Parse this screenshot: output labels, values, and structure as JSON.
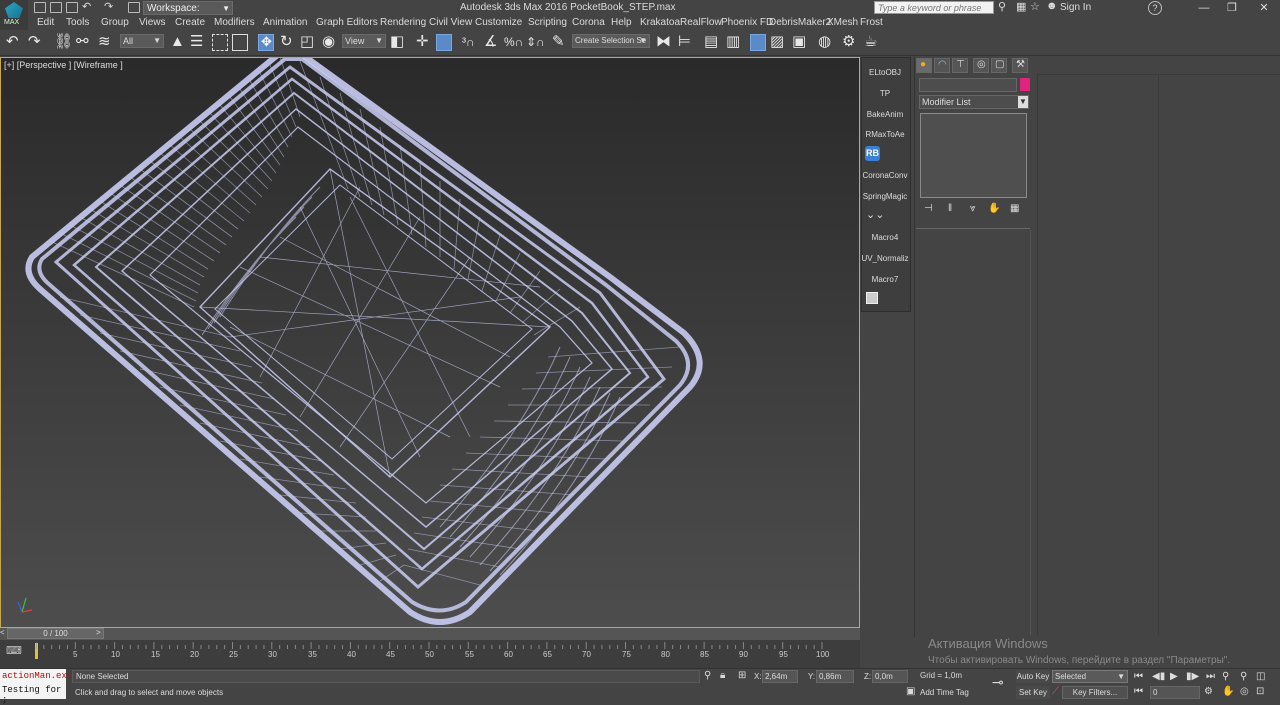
{
  "titlebar": {
    "logo_label": "MAX",
    "workspace": "Workspace: Default",
    "app_title": "Autodesk 3ds Max 2016     PocketBook_STEP.max",
    "search_placeholder": "Type a keyword or phrase",
    "sign_in": "Sign In",
    "help_glyph": "?",
    "minimize": "—",
    "maximize": "❐",
    "close": "✕"
  },
  "menu": [
    "Edit",
    "Tools",
    "Group",
    "Views",
    "Create",
    "Modifiers",
    "Animation",
    "Graph Editors",
    "Rendering",
    "Civil View",
    "Customize",
    "Scripting",
    "Corona",
    "Help",
    "Krakatoa",
    "RealFlow",
    "Phoenix FD",
    "DebrisMaker2",
    "XMesh",
    "Frost"
  ],
  "toolbar": {
    "selection_filter": "All",
    "reference_coord": "View",
    "selection_set": "Create Selection Se"
  },
  "viewport": {
    "label": "[+] [Perspective ] [Wireframe ]"
  },
  "macros": [
    "ELtoOBJ",
    "TP",
    "BakeAnim",
    "RMaxToAe",
    "RB",
    "CoronaConv",
    "SpringMagic",
    "Macro4",
    "UV_Normaliz",
    "Macro7"
  ],
  "command_panel": {
    "modifier_list": "Modifier List"
  },
  "timeline": {
    "slider_text": "0 / 100",
    "ticks": [
      "5",
      "10",
      "15",
      "20",
      "25",
      "30",
      "35",
      "40",
      "45",
      "50",
      "55",
      "60",
      "65",
      "70",
      "75",
      "80",
      "85",
      "90",
      "95",
      "100"
    ]
  },
  "status": {
    "maxscript_line1": "actionMan.exe",
    "maxscript_line2": "Testing for ;",
    "selection": "None Selected",
    "prompt": "Click and drag to select and move objects",
    "x_label": "X:",
    "x_value": "2,64m",
    "y_label": "Y:",
    "y_value": "0,86m",
    "z_label": "Z:",
    "z_value": "0,0m",
    "grid": "Grid = 1,0m",
    "add_time_tag": "Add Time Tag",
    "auto_key": "Auto Key",
    "set_key": "Set Key",
    "key_mode": "Selected",
    "key_filters": "Key Filters...",
    "frame": "0"
  },
  "activation": {
    "line1": "Активация Windows",
    "line2": "Чтобы активировать Windows, перейдите в раздел \"Параметры\"."
  }
}
